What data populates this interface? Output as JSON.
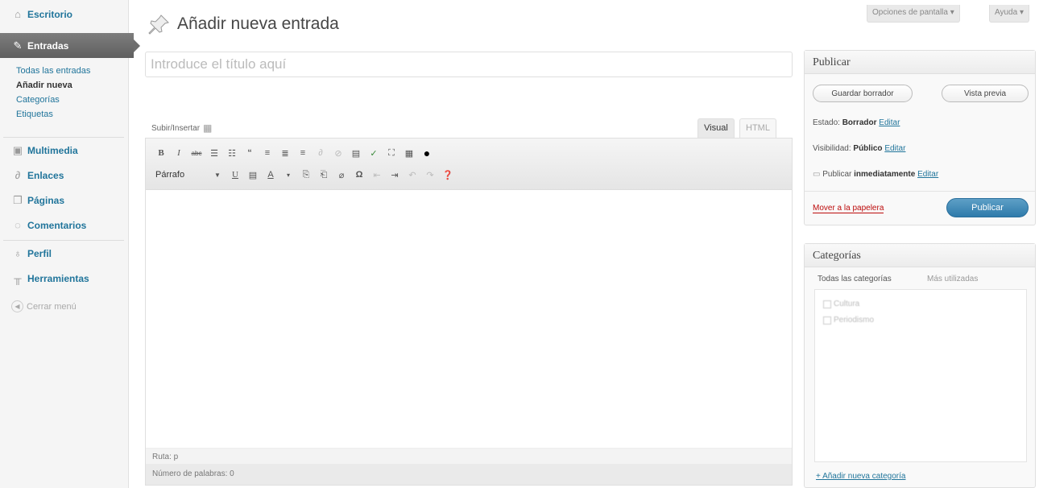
{
  "menu": {
    "dashboard": "Escritorio",
    "posts": "Entradas",
    "posts_sub": [
      "Todas las entradas",
      "Añadir nueva",
      "Categorías",
      "Etiquetas"
    ],
    "media": "Multimedia",
    "links": "Enlaces",
    "pages": "Páginas",
    "comments": "Comentarios",
    "profile": "Perfil",
    "tools": "Herramientas",
    "collapse": "Cerrar menú"
  },
  "screen_options": "Opciones de pantalla ▾",
  "help": "Ayuda ▾",
  "page_title": "Añadir nueva entrada",
  "title_placeholder": "Introduce el título aquí",
  "upload_label": "Subir/Insertar",
  "editor": {
    "tab_visual": "Visual",
    "tab_html": "HTML",
    "format_select": "Párrafo",
    "path": "Ruta: p",
    "word_count": "Número de palabras: 0"
  },
  "publish": {
    "heading": "Publicar",
    "save_draft": "Guardar borrador",
    "preview": "Vista previa",
    "status_label": "Estado:",
    "status_value": "Borrador",
    "visibility_label": "Visibilidad:",
    "visibility_value": "Público",
    "publish_label": "Publicar",
    "publish_value": "inmediatamente",
    "edit": "Editar",
    "trash": "Mover a la papelera",
    "publish_button": "Publicar"
  },
  "categories": {
    "heading": "Categorías",
    "tab_all": "Todas las categorías",
    "tab_popular": "Más utilizadas",
    "items": [
      "Cultura",
      "Periodismo"
    ],
    "add_new": "+ Añadir nueva categoría"
  }
}
